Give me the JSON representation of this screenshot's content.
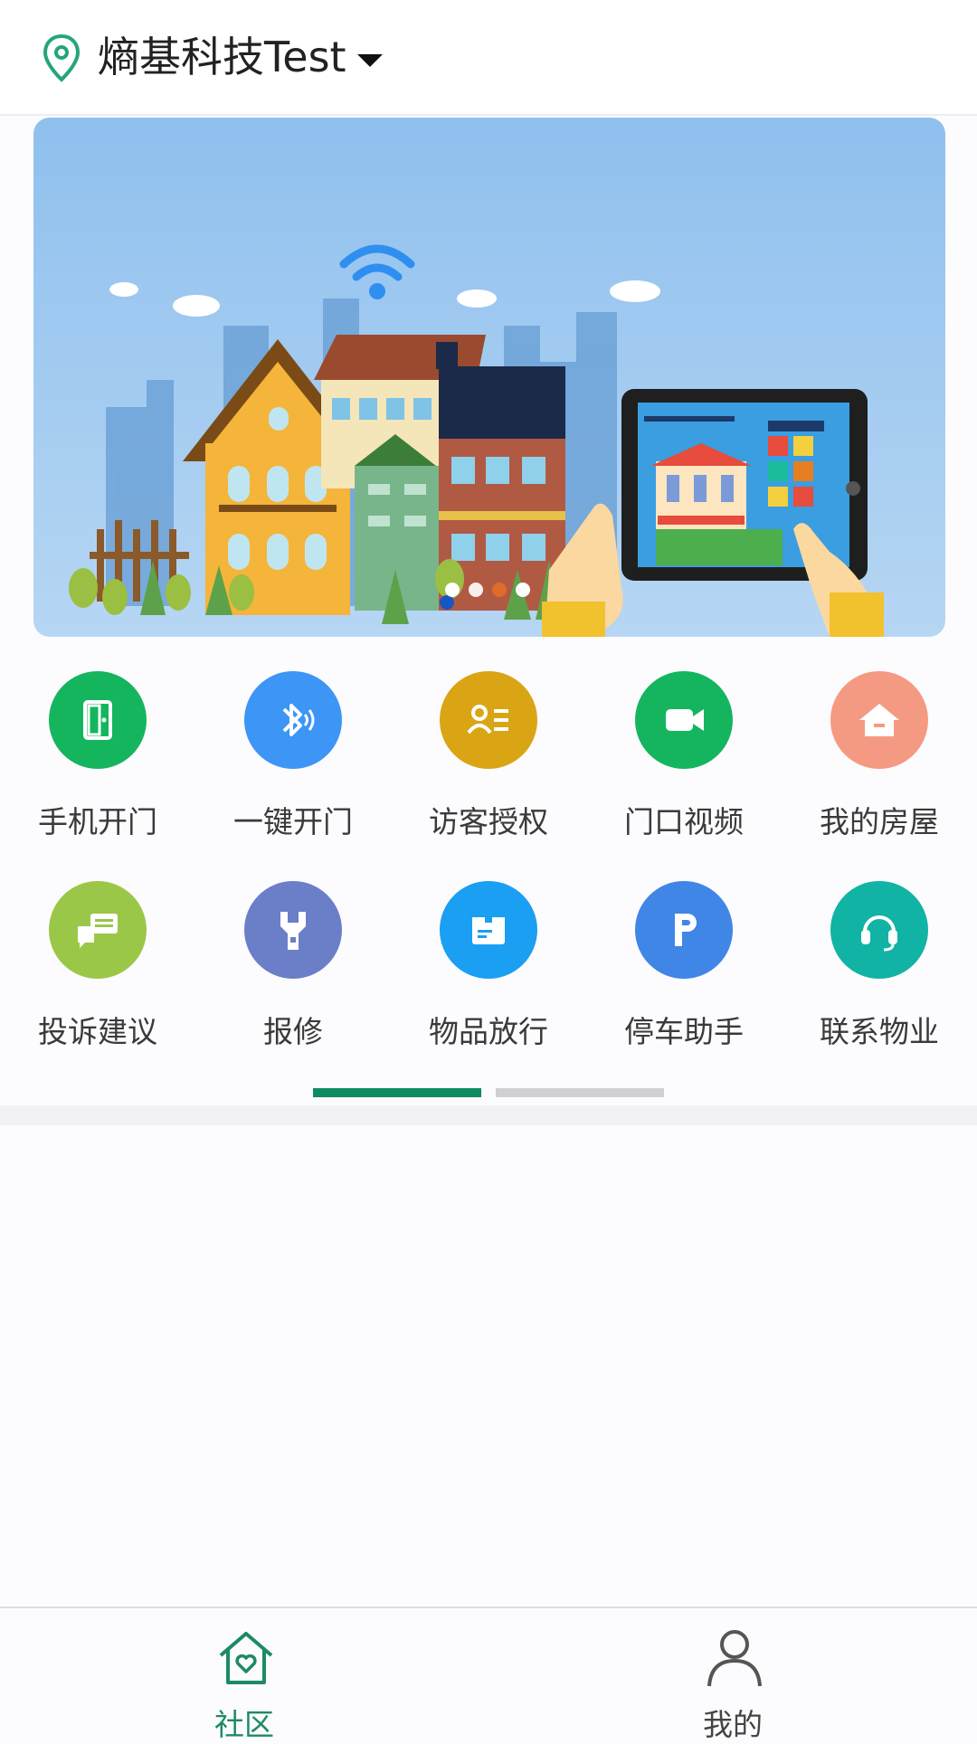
{
  "header": {
    "title": "熵基科技Test",
    "location_icon": "location-pin-icon",
    "dropdown_icon": "caret-down-icon"
  },
  "banner": {
    "description_icon": "smart-community-illustration"
  },
  "services": [
    {
      "label": "手机开门",
      "icon": "phone-door-icon",
      "color": "#15b55e"
    },
    {
      "label": "一键开门",
      "icon": "bluetooth-icon",
      "color": "#3d95f5"
    },
    {
      "label": "访客授权",
      "icon": "visitor-list-icon",
      "color": "#d9a514"
    },
    {
      "label": "门口视频",
      "icon": "video-camera-icon",
      "color": "#14b55e"
    },
    {
      "label": "我的房屋",
      "icon": "house-icon",
      "color": "#f59a82"
    },
    {
      "label": "投诉建议",
      "icon": "chat-bubble-icon",
      "color": "#9bc748"
    },
    {
      "label": "报修",
      "icon": "wrench-icon",
      "color": "#6b7fc9"
    },
    {
      "label": "物品放行",
      "icon": "package-icon",
      "color": "#1a9ff2"
    },
    {
      "label": "停车助手",
      "icon": "parking-icon",
      "color": "#3f86e6"
    },
    {
      "label": "联系物业",
      "icon": "headset-icon",
      "color": "#11b3a4"
    }
  ],
  "pager": {
    "active_color": "#0d8a60",
    "inactive_color": "#cfcfd4"
  },
  "tabbar": {
    "tabs": [
      {
        "label": "社区",
        "icon": "home-heart-icon",
        "active": true,
        "color": "#1d8a65"
      },
      {
        "label": "我的",
        "icon": "user-icon",
        "active": false,
        "color": "#444444"
      }
    ]
  }
}
